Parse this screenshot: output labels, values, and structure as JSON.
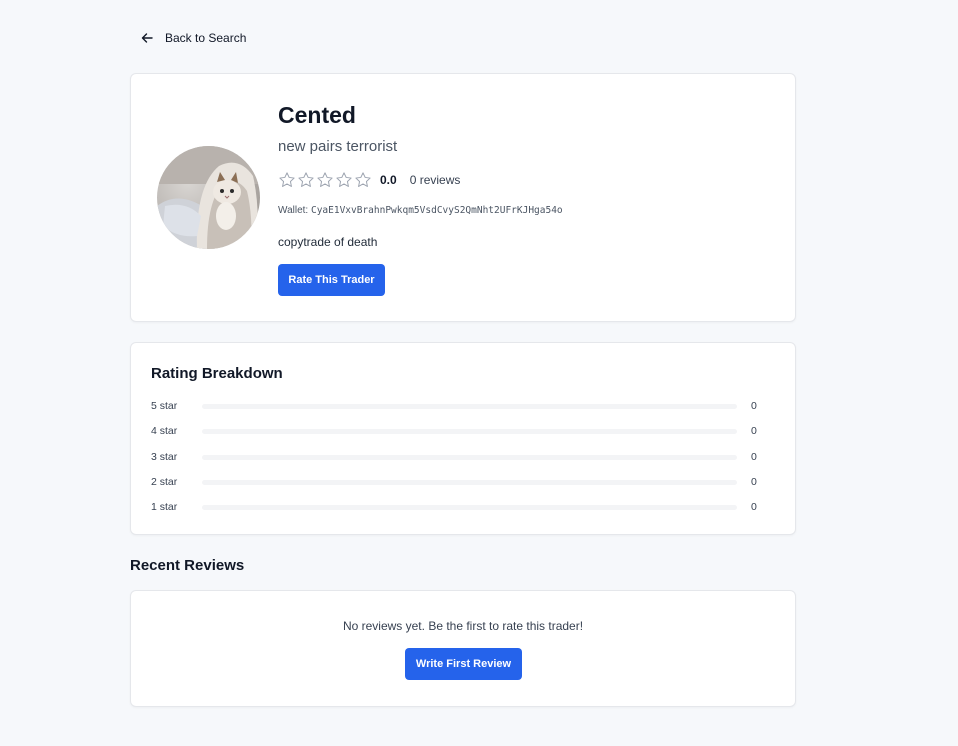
{
  "nav": {
    "back_label": "Back to Search",
    "back_icon": "arrow-left-icon"
  },
  "profile": {
    "name": "Cented",
    "tagline": "new pairs terrorist",
    "rating": 0,
    "rating_display": "0.0",
    "reviews_label": "0 reviews",
    "wallet_label": "Wallet:",
    "wallet_address": "CyaE1VxvBrahnPwkqm5VsdCvyS2QmNht2UFrKJHga54o",
    "bio": "copytrade of death",
    "rate_button": "Rate This Trader",
    "avatar": "cat-in-blanket-avatar"
  },
  "breakdown": {
    "title": "Rating Breakdown",
    "rows": [
      {
        "label": "5 star",
        "count": "0",
        "fraction": 0
      },
      {
        "label": "4 star",
        "count": "0",
        "fraction": 0
      },
      {
        "label": "3 star",
        "count": "0",
        "fraction": 0
      },
      {
        "label": "2 star",
        "count": "0",
        "fraction": 0
      },
      {
        "label": "1 star",
        "count": "0",
        "fraction": 0
      }
    ]
  },
  "recent": {
    "title": "Recent Reviews",
    "empty_text": "No reviews yet. Be the first to rate this trader!",
    "write_button": "Write First Review"
  },
  "colors": {
    "primary": "#2563eb",
    "star_outline": "#9ca3af",
    "card_border": "#e5e7eb",
    "background": "#f6f8fb"
  }
}
